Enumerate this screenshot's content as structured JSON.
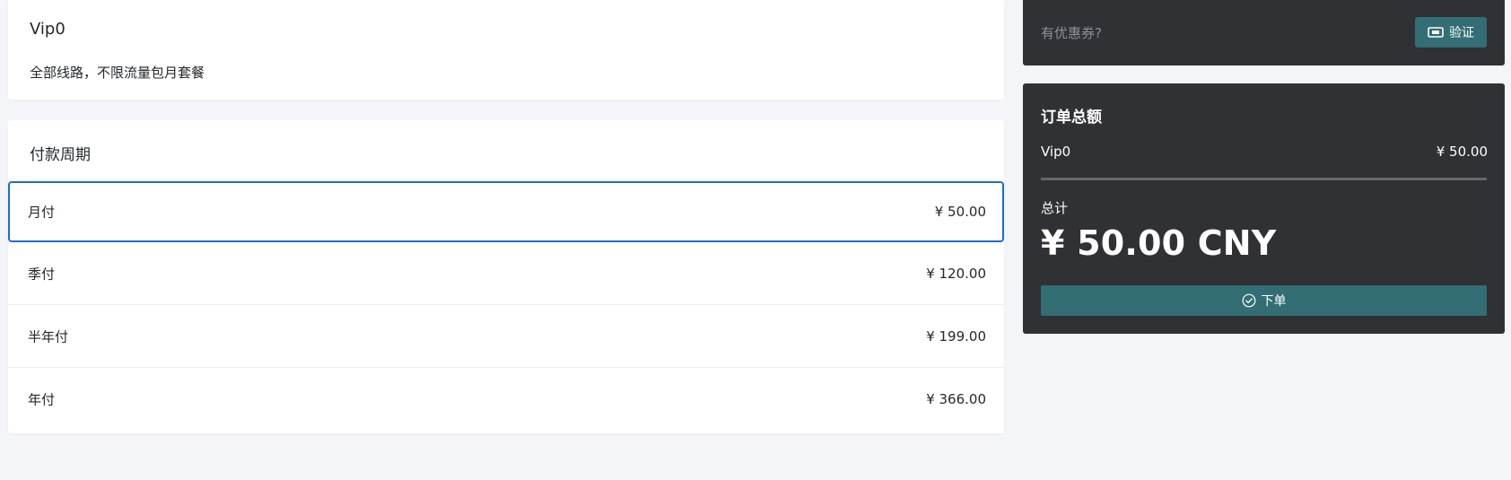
{
  "plan": {
    "name": "Vip0",
    "description": "全部线路，不限流量包月套餐"
  },
  "period_section": {
    "title": "付款周期",
    "selected_index": 0,
    "options": [
      {
        "label": "月付",
        "price": "¥ 50.00"
      },
      {
        "label": "季付",
        "price": "¥ 120.00"
      },
      {
        "label": "半年付",
        "price": "¥ 199.00"
      },
      {
        "label": "年付",
        "price": "¥ 366.00"
      }
    ]
  },
  "coupon": {
    "placeholder": "有优惠券?",
    "value": "",
    "verify_label": "验证",
    "verify_icon": "ticket-icon"
  },
  "order_summary": {
    "title": "订单总额",
    "line_item": {
      "name": "Vip0",
      "price": "¥ 50.00"
    },
    "total_label": "总计",
    "total_amount": "¥ 50.00 CNY",
    "submit_label": "下单",
    "submit_icon": "check-circle-icon"
  },
  "colors": {
    "accent": "#326e74",
    "selected_border": "#1e6bd6",
    "dark_panel": "#2f3135",
    "page_bg": "#f4f5f9"
  }
}
